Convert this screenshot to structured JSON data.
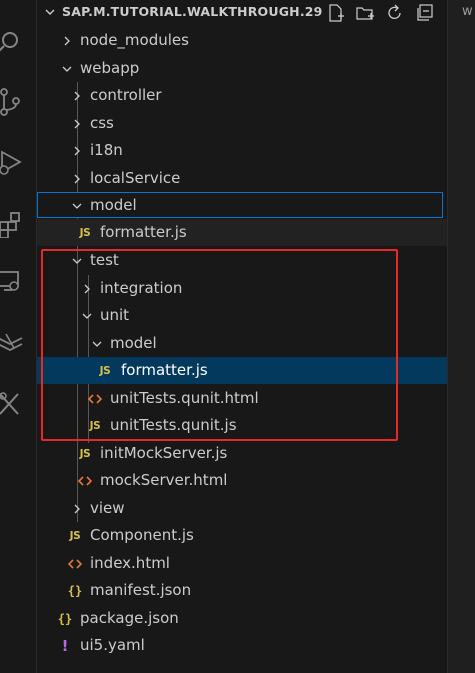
{
  "explorer": {
    "title": "SAP.M.TUTORIAL.WALKTHROUGH.29",
    "actions": [
      {
        "name": "new-file-button",
        "icon": "new-file-icon"
      },
      {
        "name": "new-folder-button",
        "icon": "new-folder-icon"
      },
      {
        "name": "refresh-button",
        "icon": "refresh-icon"
      },
      {
        "name": "collapse-all-button",
        "icon": "collapse-all-icon"
      }
    ]
  },
  "activity_bar": [
    "search-icon",
    "source-control-icon",
    "run-debug-icon",
    "extensions-icon",
    "remote-explorer-icon",
    "sap-tools-icon",
    "testing-icon"
  ],
  "tree": {
    "node_modules": "node_modules",
    "webapp": "webapp",
    "controller": "controller",
    "css": "css",
    "i18n": "i18n",
    "localService": "localService",
    "model": "model",
    "model_formatter": "formatter.js",
    "test": "test",
    "integration": "integration",
    "unit": "unit",
    "unit_model": "model",
    "unit_model_formatter": "formatter.js",
    "unitTests_html": "unitTests.qunit.html",
    "unitTests_js": "unitTests.qunit.js",
    "initMockServer": "initMockServer.js",
    "mockServer": "mockServer.html",
    "view": "view",
    "component": "Component.js",
    "index": "index.html",
    "manifest": "manifest.json",
    "package": "package.json",
    "ui5yaml": "ui5.yaml"
  },
  "icon_glyphs": {
    "js": "JS",
    "json": "{}",
    "yaml": "!"
  },
  "editor_peek": "w",
  "colors": {
    "background": "#181818",
    "selection": "#04395e",
    "focus_border": "#0078d4",
    "highlight_annotation": "#e52a2a",
    "js_icon": "#d7c14a",
    "html_icon": "#e37933",
    "yaml_icon": "#b46be0"
  }
}
